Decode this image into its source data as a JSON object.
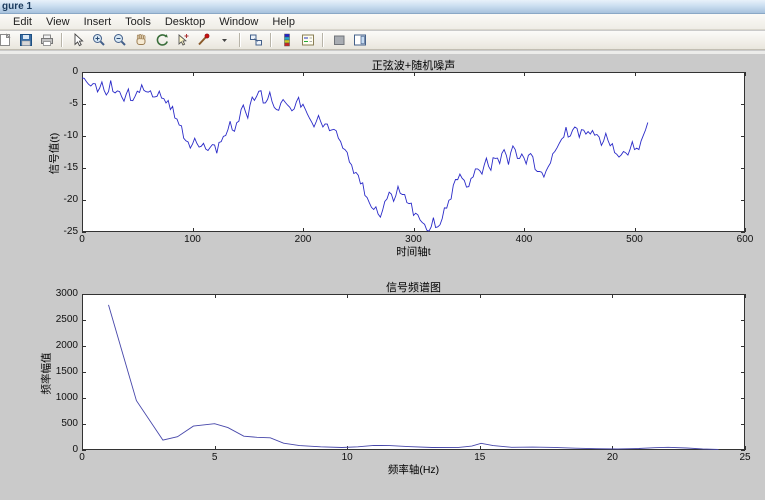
{
  "window": {
    "title": "gure 1"
  },
  "menu": {
    "items": [
      "Edit",
      "View",
      "Insert",
      "Tools",
      "Desktop",
      "Window",
      "Help"
    ]
  },
  "toolbar": {
    "groups": [
      [
        "new-figure",
        "save",
        "print"
      ],
      [
        "edit-plot",
        "zoom-in",
        "zoom-out",
        "pan",
        "rotate-3d",
        "data-cursor",
        "brush",
        "brush-dropdown"
      ],
      [
        "link-plot"
      ],
      [
        "colorbar",
        "legend"
      ],
      [
        "hide-plot-tools",
        "show-plot-tools"
      ]
    ]
  },
  "colors": {
    "figure_background": "#cacaca",
    "plot_background": "#ffffff",
    "axis": "#333333",
    "signal_line": "#2b2bc8",
    "spectrum_line": "#4747aa",
    "titlebar": "#a7c2dd"
  },
  "chart_data": [
    {
      "type": "line",
      "title": "正弦波+随机噪声",
      "xlabel": "时间轴t",
      "ylabel": "信号值(t)",
      "xlim": [
        0,
        600
      ],
      "ylim": [
        -25,
        0
      ],
      "xticks": [
        0,
        100,
        200,
        300,
        400,
        500,
        600
      ],
      "yticks": [
        0,
        -5,
        -10,
        -15,
        -20,
        -25
      ],
      "grid": false,
      "line_color": "#2b2bc8",
      "noise": {
        "amplitude": 0.7,
        "step": 2,
        "seed": 123456789
      },
      "x_end": 512,
      "trend_points": [
        [
          0,
          -0.4
        ],
        [
          6,
          -2.6
        ],
        [
          10,
          -1.4
        ],
        [
          14,
          -3.0
        ],
        [
          18,
          -1.8
        ],
        [
          22,
          -3.4
        ],
        [
          26,
          -2.0
        ],
        [
          30,
          -3.6
        ],
        [
          34,
          -2.4
        ],
        [
          38,
          -4.4
        ],
        [
          42,
          -3.0
        ],
        [
          46,
          -4.6
        ],
        [
          50,
          -3.4
        ],
        [
          54,
          -2.4
        ],
        [
          58,
          -3.6
        ],
        [
          62,
          -2.6
        ],
        [
          66,
          -4.0
        ],
        [
          70,
          -3.0
        ],
        [
          74,
          -4.4
        ],
        [
          78,
          -4.8
        ],
        [
          82,
          -6.0
        ],
        [
          86,
          -7.5
        ],
        [
          90,
          -9.0
        ],
        [
          94,
          -10.5
        ],
        [
          98,
          -11.3
        ],
        [
          102,
          -10.2
        ],
        [
          106,
          -11.6
        ],
        [
          110,
          -10.8
        ],
        [
          114,
          -12.2
        ],
        [
          118,
          -11.4
        ],
        [
          122,
          -12.3
        ],
        [
          126,
          -11.0
        ],
        [
          130,
          -9.6
        ],
        [
          134,
          -8.0
        ],
        [
          138,
          -9.6
        ],
        [
          142,
          -7.0
        ],
        [
          146,
          -5.4
        ],
        [
          150,
          -7.0
        ],
        [
          154,
          -4.6
        ],
        [
          158,
          -3.4
        ],
        [
          162,
          -3.2
        ],
        [
          166,
          -5.4
        ],
        [
          170,
          -3.8
        ],
        [
          174,
          -5.0
        ],
        [
          178,
          -6.2
        ],
        [
          182,
          -4.4
        ],
        [
          186,
          -5.4
        ],
        [
          190,
          -6.6
        ],
        [
          194,
          -4.2
        ],
        [
          198,
          -5.0
        ],
        [
          202,
          -5.8
        ],
        [
          206,
          -7.0
        ],
        [
          210,
          -8.2
        ],
        [
          214,
          -7.4
        ],
        [
          218,
          -8.6
        ],
        [
          222,
          -7.6
        ],
        [
          226,
          -9.6
        ],
        [
          230,
          -8.8
        ],
        [
          234,
          -10.8
        ],
        [
          238,
          -12.2
        ],
        [
          242,
          -13.8
        ],
        [
          246,
          -15.2
        ],
        [
          250,
          -16.6
        ],
        [
          254,
          -18.0
        ],
        [
          258,
          -19.4
        ],
        [
          262,
          -20.6
        ],
        [
          266,
          -21.6
        ],
        [
          270,
          -22.1
        ],
        [
          274,
          -20.4
        ],
        [
          278,
          -18.6
        ],
        [
          282,
          -19.6
        ],
        [
          286,
          -17.8
        ],
        [
          290,
          -18.8
        ],
        [
          294,
          -20.2
        ],
        [
          298,
          -21.2
        ],
        [
          302,
          -22.4
        ],
        [
          306,
          -23.4
        ],
        [
          310,
          -24.2
        ],
        [
          314,
          -24.6
        ],
        [
          318,
          -23.2
        ],
        [
          322,
          -24.2
        ],
        [
          326,
          -22.6
        ],
        [
          330,
          -21.0
        ],
        [
          334,
          -19.2
        ],
        [
          338,
          -17.4
        ],
        [
          342,
          -16.2
        ],
        [
          346,
          -17.6
        ],
        [
          350,
          -18.4
        ],
        [
          354,
          -16.0
        ],
        [
          358,
          -14.6
        ],
        [
          362,
          -15.8
        ],
        [
          366,
          -13.8
        ],
        [
          370,
          -14.8
        ],
        [
          374,
          -13.0
        ],
        [
          378,
          -14.2
        ],
        [
          382,
          -12.4
        ],
        [
          386,
          -13.8
        ],
        [
          390,
          -11.8
        ],
        [
          394,
          -13.2
        ],
        [
          398,
          -12.8
        ],
        [
          402,
          -14.0
        ],
        [
          406,
          -13.0
        ],
        [
          410,
          -14.6
        ],
        [
          414,
          -15.4
        ],
        [
          418,
          -16.0
        ],
        [
          422,
          -14.6
        ],
        [
          426,
          -13.0
        ],
        [
          430,
          -11.6
        ],
        [
          434,
          -10.2
        ],
        [
          438,
          -9.0
        ],
        [
          442,
          -10.4
        ],
        [
          446,
          -8.2
        ],
        [
          450,
          -9.6
        ],
        [
          454,
          -8.4
        ],
        [
          458,
          -9.8
        ],
        [
          462,
          -8.6
        ],
        [
          466,
          -10.2
        ],
        [
          470,
          -11.0
        ],
        [
          474,
          -9.4
        ],
        [
          478,
          -11.0
        ],
        [
          482,
          -12.2
        ],
        [
          486,
          -13.6
        ],
        [
          490,
          -12.2
        ],
        [
          494,
          -13.2
        ],
        [
          498,
          -11.2
        ],
        [
          502,
          -12.6
        ],
        [
          506,
          -10.4
        ],
        [
          510,
          -9.0
        ],
        [
          512,
          -8.4
        ]
      ]
    },
    {
      "type": "line",
      "title": "信号频谱图",
      "xlabel": "频率轴(Hz)",
      "ylabel": "频率幅值",
      "xlim": [
        0,
        25
      ],
      "ylim": [
        0,
        3000
      ],
      "xticks": [
        0,
        5,
        10,
        15,
        20,
        25
      ],
      "yticks": [
        0,
        500,
        1000,
        1500,
        2000,
        2500,
        3000
      ],
      "grid": false,
      "line_color": "#4747aa",
      "points": [
        [
          1,
          2790
        ],
        [
          2.05,
          950
        ],
        [
          3.05,
          190
        ],
        [
          3.6,
          255
        ],
        [
          4.2,
          460
        ],
        [
          5,
          505
        ],
        [
          5.5,
          430
        ],
        [
          6.1,
          265
        ],
        [
          6.6,
          245
        ],
        [
          7.1,
          235
        ],
        [
          7.6,
          130
        ],
        [
          8.2,
          85
        ],
        [
          9,
          62
        ],
        [
          9.8,
          48
        ],
        [
          10.4,
          62
        ],
        [
          11,
          88
        ],
        [
          11.6,
          85
        ],
        [
          12.3,
          65
        ],
        [
          13.2,
          48
        ],
        [
          14.2,
          50
        ],
        [
          14.7,
          75
        ],
        [
          15.05,
          128
        ],
        [
          15.5,
          85
        ],
        [
          16.2,
          52
        ],
        [
          17,
          55
        ],
        [
          17.8,
          50
        ],
        [
          18.6,
          35
        ],
        [
          19.4,
          25
        ],
        [
          20.2,
          22
        ],
        [
          21,
          28
        ],
        [
          21.6,
          45
        ],
        [
          22.1,
          52
        ],
        [
          22.8,
          38
        ],
        [
          23.4,
          22
        ],
        [
          24,
          12
        ]
      ]
    }
  ]
}
